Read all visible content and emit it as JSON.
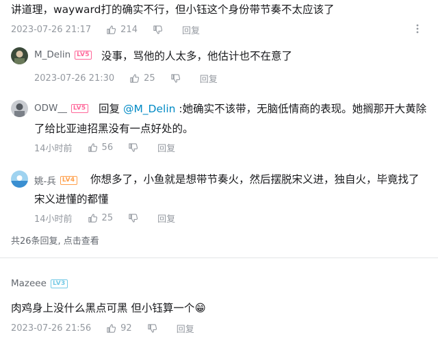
{
  "main_comment": {
    "text": "讲道理，wayward打的确实不行，但小钰这个身份带节奏不太应该了",
    "time": "2023-07-26 21:17",
    "likes": "214",
    "reply_label": "回复"
  },
  "replies": [
    {
      "user": "M_Delin",
      "level": "LV5",
      "text": "没事，骂他的人太多，他估计也不在意了",
      "time": "2023-07-26 21:30",
      "likes": "25",
      "reply_label": "回复"
    },
    {
      "user": "ODW__",
      "level": "LV5",
      "prefix": "回复 ",
      "mention": "@M_Delin",
      "text_line1": " :她确实不该带，无脑低情商的表现。她搁那开大黄除",
      "text_line2": "了给比亚迪招黑没有一点好处的。",
      "time": "14小时前",
      "likes": "56",
      "reply_label": "回复"
    },
    {
      "user": "姚-兵",
      "level": "LV4",
      "text_line1": "你想多了，小鱼就是想带节奏火，然后摆脱宋义进，独自火，毕竟找了",
      "text_line2": "宋义进懂的都懂",
      "time": "14小时前",
      "likes": "25",
      "reply_label": "回复"
    }
  ],
  "reply_summary": "共26条回复, 点击查看",
  "second_comment": {
    "user": "Mazeee",
    "level": "LV3",
    "text": "肉鸡身上没什么黑点可黑 但小钰算一个",
    "emoji": "😁",
    "time": "2023-07-26 21:56",
    "likes": "92",
    "reply_label": "回复"
  },
  "icons": {
    "like": "thumbs-up-icon",
    "dislike": "thumbs-down-icon",
    "more": "more-dots-icon"
  },
  "colors": {
    "meta_gray": "#9499a0",
    "mention_blue": "#008ac5",
    "lv5": "#ff6699",
    "lv4": "#ff9f4a",
    "lv3": "#73c9e5"
  }
}
